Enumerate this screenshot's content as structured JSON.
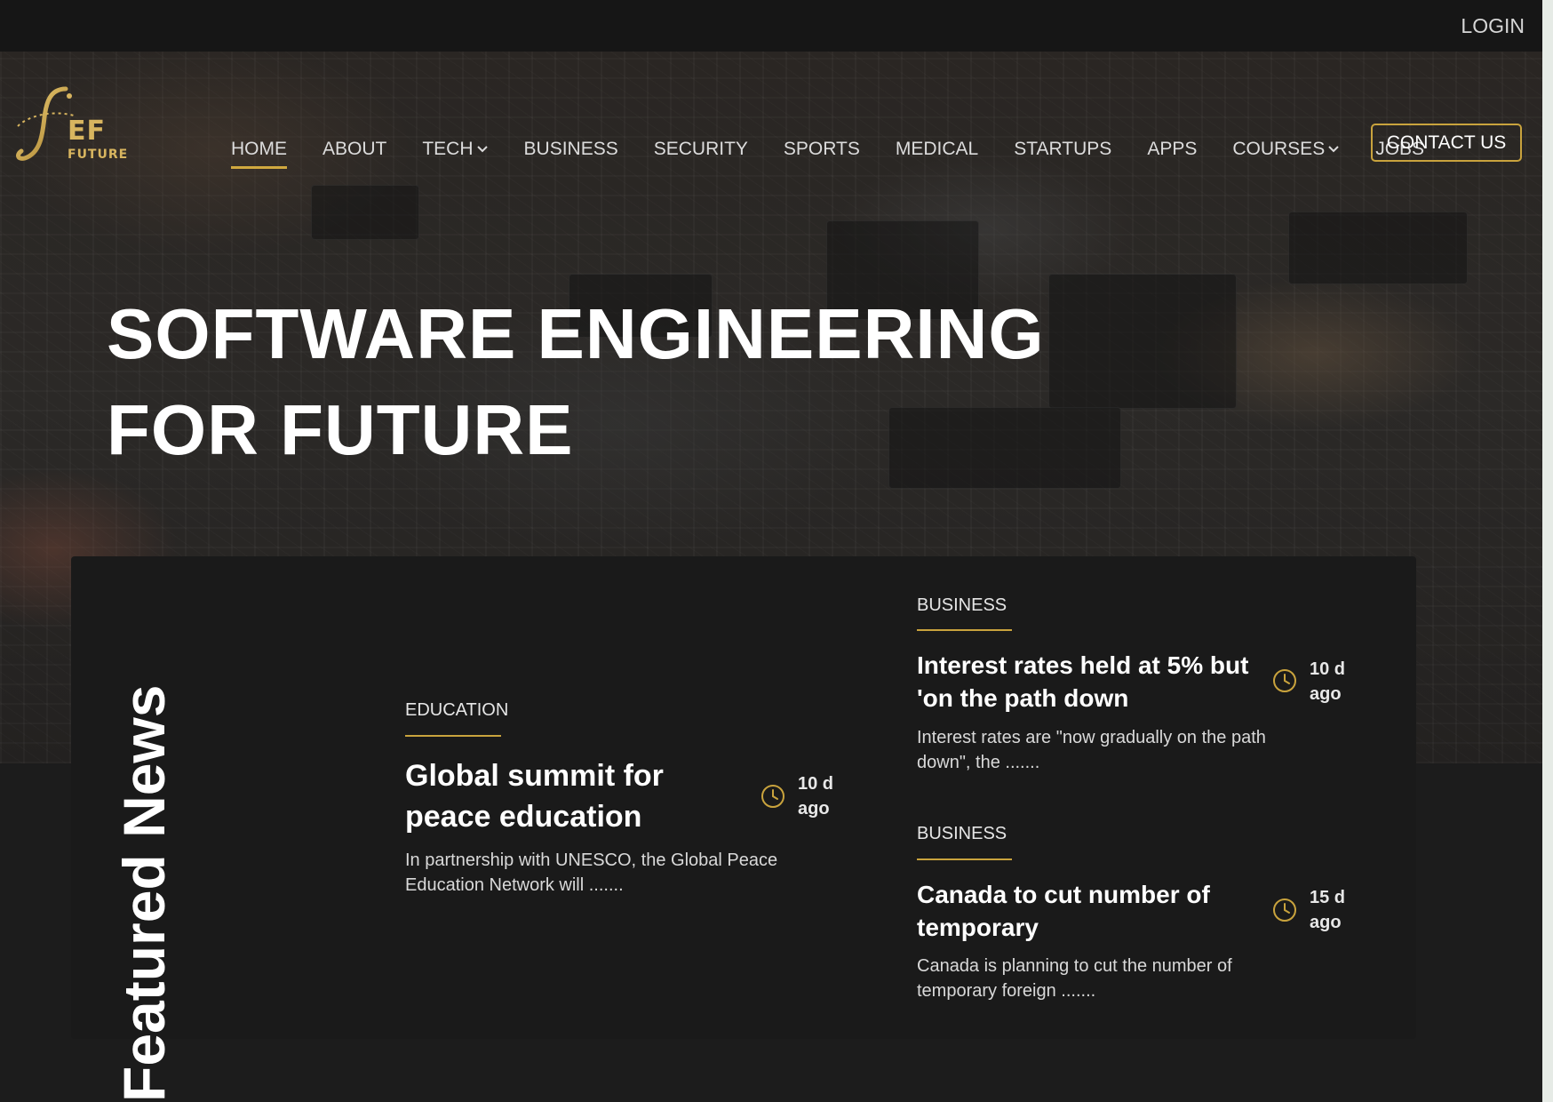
{
  "topbar": {
    "login_label": "LOGIN"
  },
  "brand": {
    "logo_text": "EF",
    "logo_subtext": "FUTURE"
  },
  "nav": {
    "items": [
      {
        "label": "HOME",
        "active": true,
        "dropdown": false
      },
      {
        "label": "ABOUT",
        "active": false,
        "dropdown": false
      },
      {
        "label": "TECH",
        "active": false,
        "dropdown": true
      },
      {
        "label": "BUSINESS",
        "active": false,
        "dropdown": false
      },
      {
        "label": "SECURITY",
        "active": false,
        "dropdown": false
      },
      {
        "label": "SPORTS",
        "active": false,
        "dropdown": false
      },
      {
        "label": "MEDICAL",
        "active": false,
        "dropdown": false
      },
      {
        "label": "STARTUPS",
        "active": false,
        "dropdown": false
      },
      {
        "label": "APPS",
        "active": false,
        "dropdown": false
      },
      {
        "label": "COURSES",
        "active": false,
        "dropdown": true
      },
      {
        "label": "JOBS",
        "active": false,
        "dropdown": false
      }
    ],
    "contact_label": "CONTACT US"
  },
  "hero": {
    "title_line1": "SOFTWARE ENGINEERING",
    "title_line2": "FOR FUTURE"
  },
  "featured": {
    "heading": "Featured News",
    "main": {
      "category": "EDUCATION",
      "title_line1": "Global summit for",
      "title_line2": "peace education",
      "time_line1": "10 d",
      "time_line2": "ago",
      "excerpt_line1": "In partnership with UNESCO, the Global Peace",
      "excerpt_line2": "Education Network will ......."
    },
    "side": [
      {
        "category": "BUSINESS",
        "title_line1": "Interest rates held at 5% but",
        "title_line2": "'on the path down",
        "time_line1": "10 d",
        "time_line2": "ago",
        "excerpt_line1": "Interest rates are \"now gradually on the path",
        "excerpt_line2": "down\", the ......."
      },
      {
        "category": "BUSINESS",
        "title_line1": "Canada to cut number of",
        "title_line2": "temporary",
        "time_line1": "15 d",
        "time_line2": "ago",
        "excerpt_line1": "Canada is planning to cut the number of",
        "excerpt_line2": "temporary foreign ......."
      }
    ]
  },
  "colors": {
    "accent_gold": "#c9a33d",
    "background": "#1c1c1c",
    "topbar": "#161616"
  }
}
